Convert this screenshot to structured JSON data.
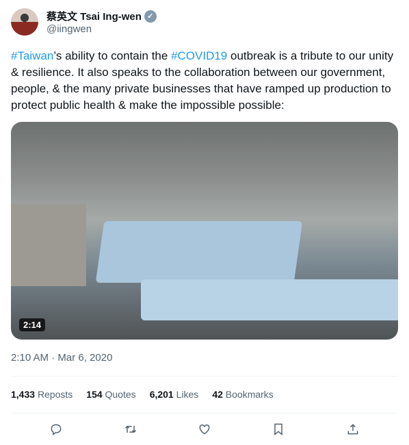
{
  "author": {
    "name": "蔡英文 Tsai Ing-wen",
    "handle": "@iingwen",
    "verified_icon": "✓"
  },
  "tweet": {
    "parts": [
      {
        "t": "#Taiwan",
        "tag": true
      },
      {
        "t": "’s ability to contain the ",
        "tag": false
      },
      {
        "t": "#COVID19",
        "tag": true
      },
      {
        "t": " outbreak is a tribute to our unity & resilience. It also speaks to the collaboration between our government, people, & the many private businesses that have ramped up production to protect public health & make the impossible possible:",
        "tag": false
      }
    ],
    "video_duration": "2:14",
    "timestamp": "2:10 AM · Mar 6, 2020"
  },
  "stats": {
    "reposts": "1,433",
    "reposts_label": "Reposts",
    "quotes": "154",
    "quotes_label": "Quotes",
    "likes": "6,201",
    "likes_label": "Likes",
    "bookmarks": "42",
    "bookmarks_label": "Bookmarks"
  },
  "colors": {
    "link": "#1d9bf0",
    "muted": "#536471"
  }
}
